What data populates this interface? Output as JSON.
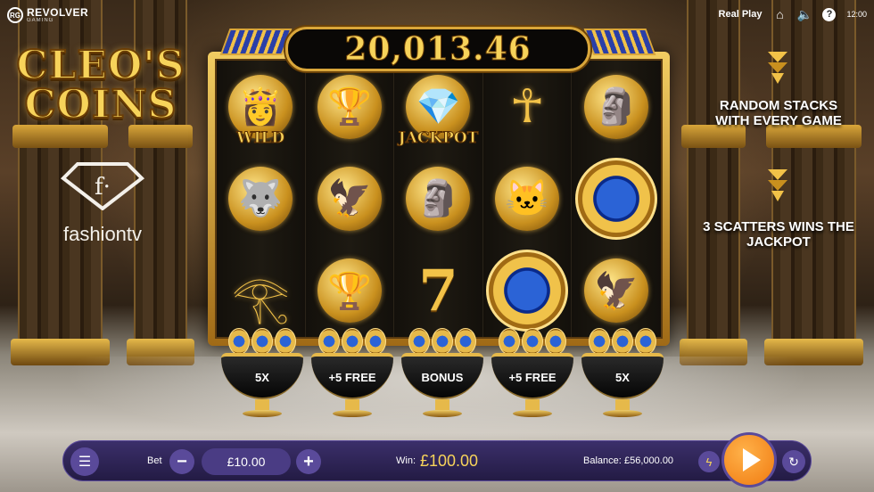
{
  "brand": {
    "mark": "RG",
    "name": "REVOLVER",
    "sub": "GAMING"
  },
  "topbar": {
    "mode": "Real Play",
    "help": "?",
    "clock": "12:00"
  },
  "game": {
    "title_line1": "CLEO'S",
    "title_line2": "COINS",
    "partner_label": "fashiontv",
    "partner_mark": "f·"
  },
  "jackpot": {
    "amount": "20,013.46"
  },
  "side_info": [
    {
      "text": "RANDOM STACKS WITH EVERY GAME"
    },
    {
      "text": "3 SCATTERS WINS THE JACKPOT"
    }
  ],
  "reels": [
    [
      {
        "symbol": "cleopatra-wild",
        "glyph": "👸",
        "caption": "WILD"
      },
      {
        "symbol": "anubis",
        "glyph": "🐺",
        "caption": ""
      },
      {
        "symbol": "eye-of-horus",
        "glyph": "𓂀",
        "caption": ""
      }
    ],
    [
      {
        "symbol": "golden-chalice",
        "glyph": "🏆",
        "caption": ""
      },
      {
        "symbol": "horus-falcon",
        "glyph": "🦅",
        "caption": ""
      },
      {
        "symbol": "golden-chalice",
        "glyph": "🏆",
        "caption": ""
      }
    ],
    [
      {
        "symbol": "jackpot-diamond",
        "glyph": "💎",
        "caption": "JACKPOT"
      },
      {
        "symbol": "pharaoh",
        "glyph": "🗿",
        "caption": ""
      },
      {
        "symbol": "seven",
        "glyph": "7",
        "caption": ""
      }
    ],
    [
      {
        "symbol": "ankh",
        "glyph": "☥",
        "caption": ""
      },
      {
        "symbol": "bastet-cat",
        "glyph": "🐱",
        "caption": ""
      },
      {
        "symbol": "blue-gem-coin",
        "glyph": "",
        "caption": ""
      }
    ],
    [
      {
        "symbol": "pharaoh",
        "glyph": "🗿",
        "caption": ""
      },
      {
        "symbol": "blue-gem-coin",
        "glyph": "",
        "caption": ""
      },
      {
        "symbol": "horus-falcon",
        "glyph": "🦅",
        "caption": ""
      }
    ]
  ],
  "bowls": [
    {
      "label": "5X"
    },
    {
      "label": "+5 FREE"
    },
    {
      "label": "BONUS"
    },
    {
      "label": "+5 FREE"
    },
    {
      "label": "5X"
    }
  ],
  "controls": {
    "bet_label": "Bet",
    "minus": "−",
    "bet_value": "£10.00",
    "plus": "+",
    "win_label": "Win:",
    "win_value": "£100.00",
    "balance_label": "Balance:",
    "balance_value": "£56,000.00",
    "turbo_glyph": "ϟ",
    "menu_glyph": "☰",
    "auto_glyph": "↻"
  },
  "colors": {
    "gold": "#f7d35a",
    "bar": "#3b2f6a",
    "spin": "#f07a10",
    "gem": "#2b63d6"
  }
}
